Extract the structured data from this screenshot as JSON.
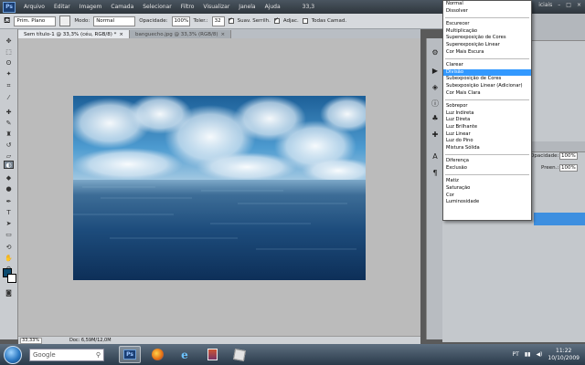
{
  "menubar": {
    "logo": "Ps",
    "items": [
      "Arquivo",
      "Editar",
      "Imagem",
      "Camada",
      "Selecionar",
      "Filtro",
      "Visualizar",
      "Janela",
      "Ajuda"
    ],
    "zoom": "33,3",
    "right_label": "iciais"
  },
  "options": {
    "brush_label": "Prim. Plano",
    "mode_label": "Modo:",
    "mode_value": "Normal",
    "opacity_label": "Opacidade:",
    "opacity_value": "100%",
    "tolerance_label": "Toler.:",
    "tolerance_value": "32",
    "antialias_label": "Suav. Serrilh.",
    "contiguous_label": "Adjac.",
    "all_layers_label": "Todas Camad."
  },
  "tabs": [
    {
      "label": "Sem título-1 @ 33,3% (céu, RGB/8) *",
      "close": "×"
    },
    {
      "label": "banguecho.jpg @ 33,3% (RGB/8)",
      "close": "×"
    }
  ],
  "status": {
    "zoom": "33,33%",
    "doc": "Doc: 6,59M/12,0M"
  },
  "blend_menu": {
    "groups": [
      [
        "Normal",
        "Dissolver"
      ],
      [
        "Escurecer",
        "Multiplicação",
        "Superexposição de Cores",
        "Superexposição Linear",
        "Cor Mais Escura"
      ],
      [
        "Clarear",
        "Divisão",
        "Subexposição de Cores",
        "Subexposição Linear (Adicionar)",
        "Cor Mais Clara"
      ],
      [
        "Sobrepor",
        "Luz Indireta",
        "Luz Direta",
        "Luz Brilhante",
        "Luz Linear",
        "Luz do Pino",
        "Mistura Sólida"
      ],
      [
        "Diferença",
        "Exclusão"
      ],
      [
        "Matiz",
        "Saturação",
        "Cor",
        "Luminosidade"
      ]
    ],
    "selected": "Divisão"
  },
  "panel": {
    "opacity_label": "Opacidade:",
    "opacity_value": "100%",
    "fill_label": "Preen.:",
    "fill_value": "100%"
  },
  "taskbar": {
    "google_label": "Google",
    "lang": "PT",
    "time": "11:22",
    "date": "10/10/2009"
  },
  "colors": {
    "foreground": "#0c4a6e",
    "background": "#ffffff",
    "selection": "#3399ff"
  },
  "icons": [
    "ps-logo-icon",
    "brush-icon",
    "start-orb-icon",
    "photoshop-task-icon",
    "firefox-icon",
    "ie-icon",
    "winrar-icon",
    "app-icon"
  ]
}
